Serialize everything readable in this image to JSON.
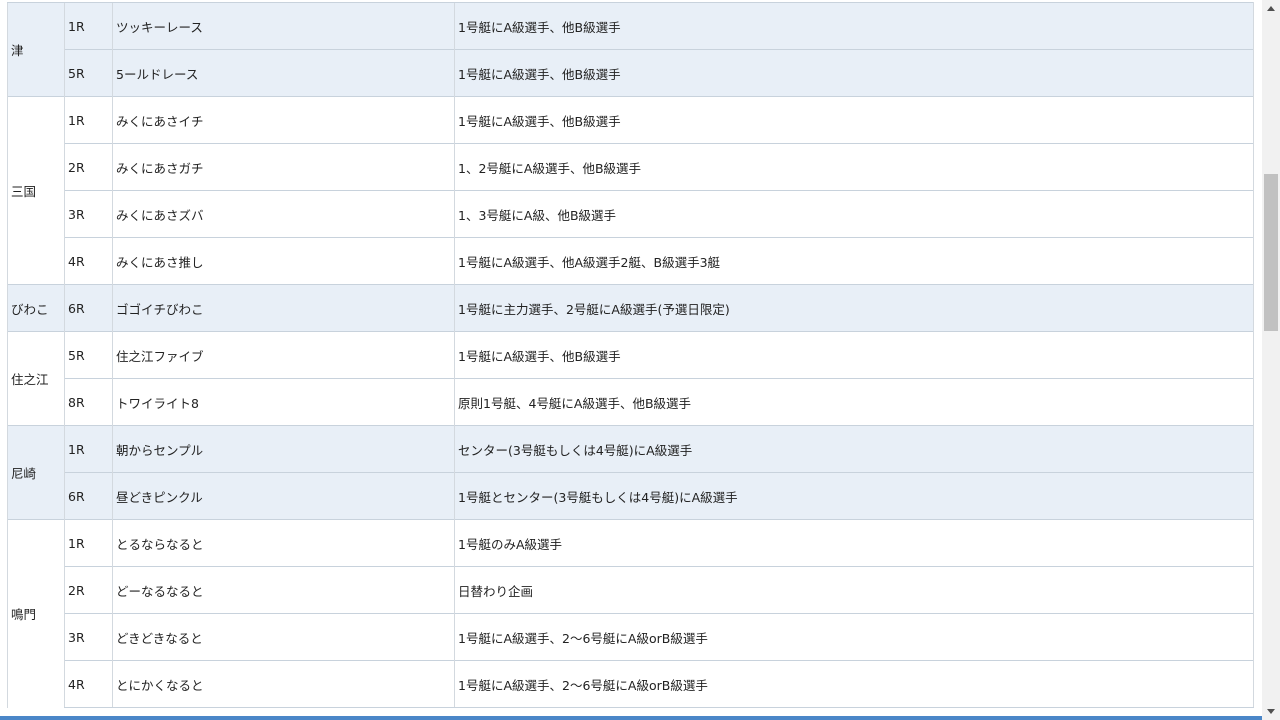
{
  "table": {
    "groups": [
      {
        "venue": "津",
        "shade": true,
        "rows": [
          {
            "race": "1R",
            "name": "ツッキーレース",
            "desc": "1号艇にA級選手、他B級選手"
          },
          {
            "race": "5R",
            "name": "5ールドレース",
            "desc": "1号艇にA級選手、他B級選手"
          }
        ]
      },
      {
        "venue": "三国",
        "shade": false,
        "rows": [
          {
            "race": "1R",
            "name": "みくにあさイチ",
            "desc": "1号艇にA級選手、他B級選手"
          },
          {
            "race": "2R",
            "name": "みくにあさガチ",
            "desc": "1、2号艇にA級選手、他B級選手"
          },
          {
            "race": "3R",
            "name": "みくにあさズバ",
            "desc": "1、3号艇にA級、他B級選手"
          },
          {
            "race": "4R",
            "name": "みくにあさ推し",
            "desc": "1号艇にA級選手、他A級選手2艇、B級選手3艇"
          }
        ]
      },
      {
        "venue": "びわこ",
        "shade": true,
        "rows": [
          {
            "race": "6R",
            "name": "ゴゴイチびわこ",
            "desc": "1号艇に主力選手、2号艇にA級選手(予選日限定)"
          }
        ]
      },
      {
        "venue": "住之江",
        "shade": false,
        "rows": [
          {
            "race": "5R",
            "name": "住之江ファイブ",
            "desc": "1号艇にA級選手、他B級選手"
          },
          {
            "race": "8R",
            "name": "トワイライト8",
            "desc": "原則1号艇、4号艇にA級選手、他B級選手"
          }
        ]
      },
      {
        "venue": "尼崎",
        "shade": true,
        "rows": [
          {
            "race": "1R",
            "name": "朝からセンプル",
            "desc": "センター(3号艇もしくは4号艇)にA級選手"
          },
          {
            "race": "6R",
            "name": "昼どきピンクル",
            "desc": "1号艇とセンター(3号艇もしくは4号艇)にA級選手"
          }
        ]
      },
      {
        "venue": "鳴門",
        "shade": false,
        "rows": [
          {
            "race": "1R",
            "name": "とるならなると",
            "desc": "1号艇のみA級選手"
          },
          {
            "race": "2R",
            "name": "どーなるなると",
            "desc": "日替わり企画"
          },
          {
            "race": "3R",
            "name": "どきどきなると",
            "desc": "1号艇にA級選手、2～6号艇にA級orB級選手"
          },
          {
            "race": "4R",
            "name": "とにかくなると",
            "desc": "1号艇にA級選手、2～6号艇にA級orB級選手"
          }
        ]
      }
    ]
  },
  "colors": {
    "shade_row": "#e8eff7",
    "accent": "#4a86c8"
  },
  "scrollbar": {
    "up_icon": "scroll-up-arrow-icon",
    "down_icon": "scroll-down-arrow-icon"
  }
}
